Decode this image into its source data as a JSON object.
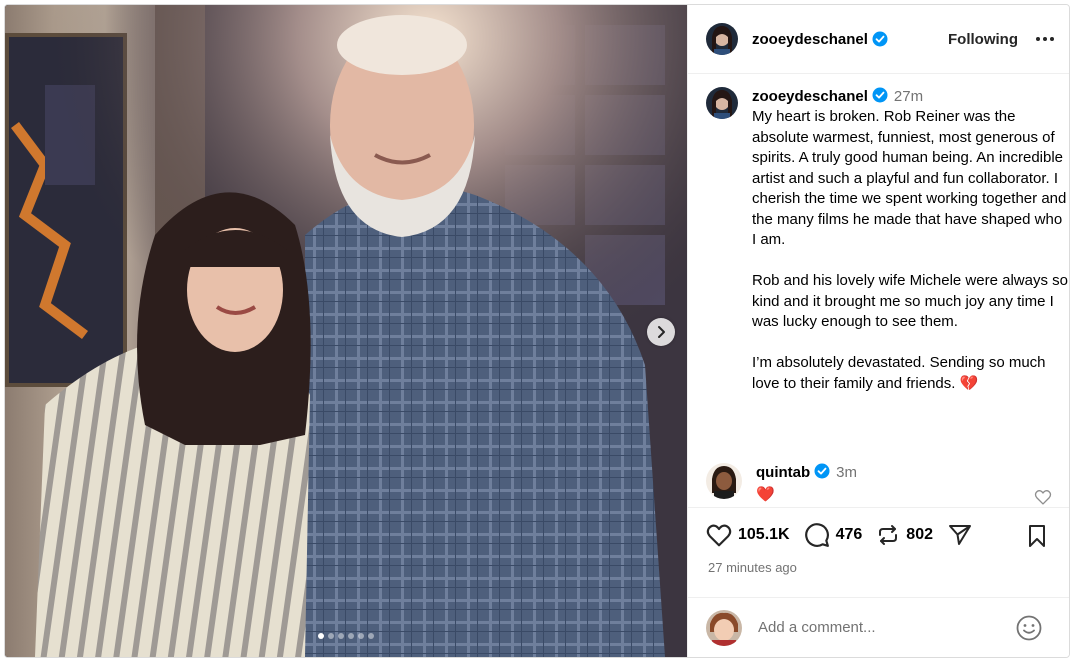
{
  "post": {
    "author": {
      "username": "zooeydeschanel",
      "verified": true,
      "avatar": "profile-photo-avatar"
    },
    "follow_label": "Following",
    "more_icon": "more-options-icon",
    "carousel": {
      "total_slides": 6,
      "current_slide": 1,
      "next_icon": "chevron-right-icon"
    },
    "caption": {
      "time_ago": "27m",
      "text": "My heart is broken. Rob Reiner was the absolute warmest, funniest, most generous of spirits. A truly good human being. An incredible artist and such a playful and fun collaborator. I cherish the time we spent working together and the many films he made that have shaped who I am.\n\nRob and his lovely wife Michele were always so kind and it brought me so much joy any time I was lucky enough to see them.\n\nI’m absolutely devastated. Sending so much love to their family and friends. 💔"
    },
    "comments": [
      {
        "username": "quintab",
        "verified": true,
        "time_ago": "3m",
        "text": "❤️"
      }
    ],
    "stats": {
      "likes": "105.1K",
      "comments": "476",
      "reposts": "802"
    },
    "posted_time": "27 minutes ago",
    "add_comment": {
      "placeholder": "Add a comment..."
    },
    "colors": {
      "verified_blue": "#0095f6",
      "heart_red": "#e0245e",
      "secondary_text": "#737373",
      "divider": "#efefef"
    }
  }
}
